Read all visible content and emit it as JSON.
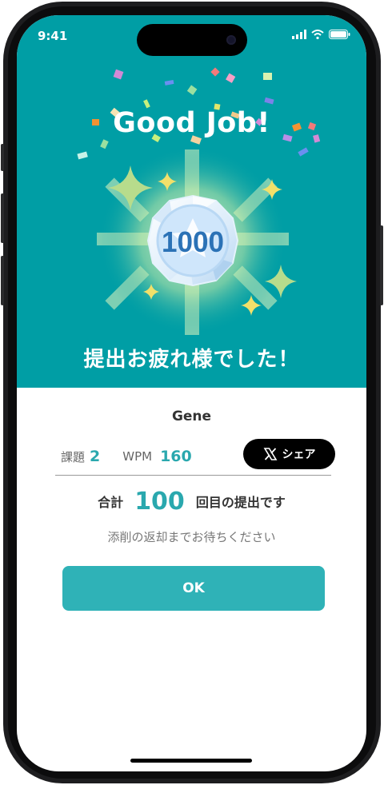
{
  "status_bar": {
    "time": "9:41"
  },
  "hero": {
    "title": "Good Job!",
    "badge_value": "1000",
    "message": "提出お疲れ様でした！"
  },
  "result": {
    "user_name": "Gene",
    "assignment_label": "課題",
    "assignment_value": "2",
    "wpm_label": "WPM",
    "wpm_value": "160",
    "share_label": "シェア",
    "total_prefix": "合計",
    "total_count": "100",
    "total_suffix": "回目の提出です",
    "wait_message": "添削の返却までお待ちください",
    "ok_label": "OK"
  },
  "colors": {
    "hero_bg": "#009ea5",
    "accent": "#2aa8ae",
    "ok_button": "#2fb2b7",
    "share_button": "#000000"
  }
}
